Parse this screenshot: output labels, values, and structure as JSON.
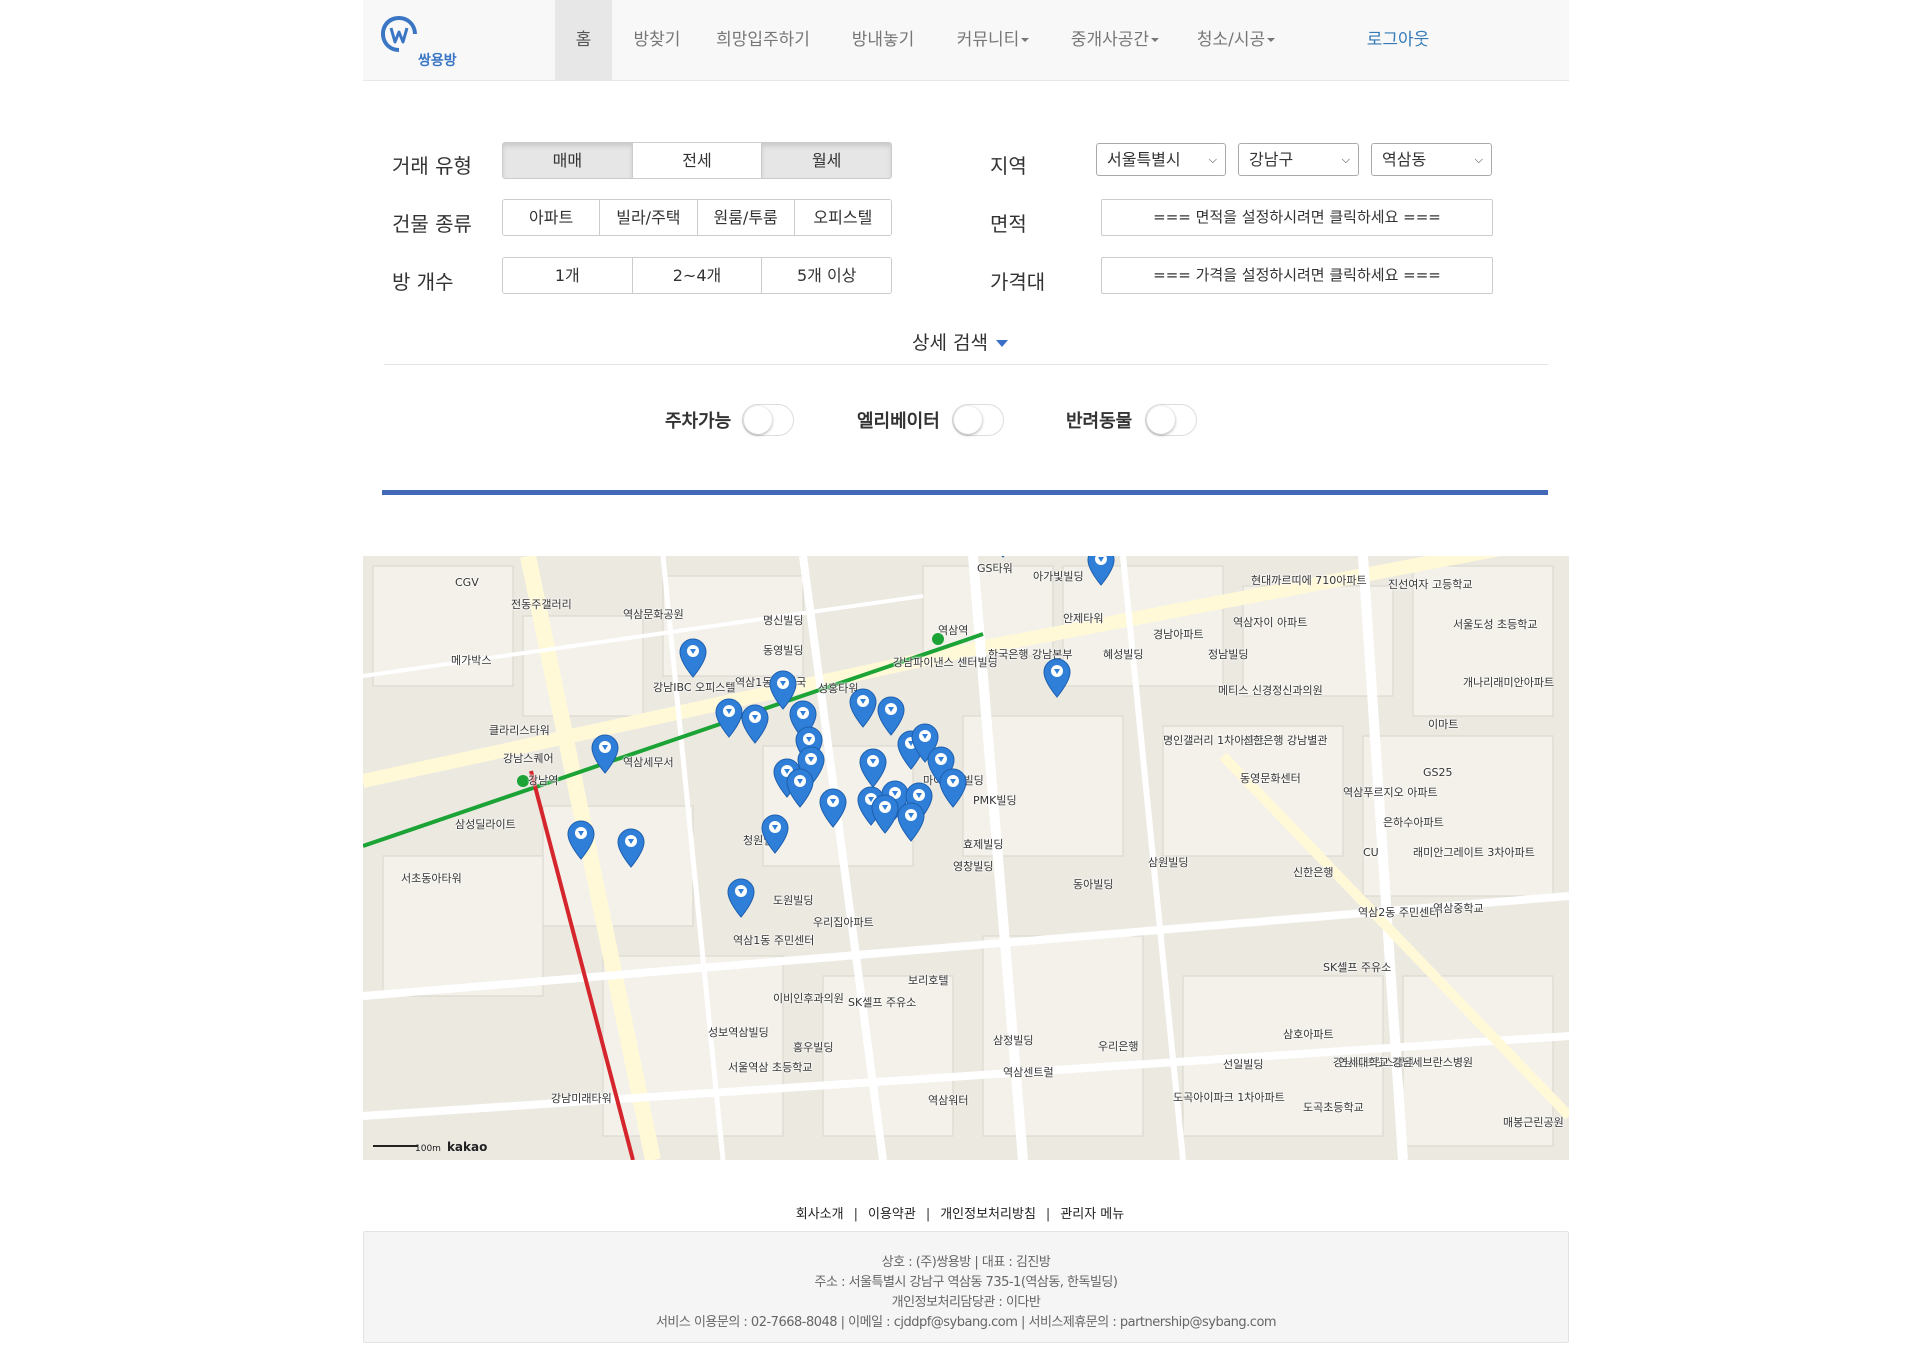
{
  "brand": {
    "name": "쌍용방"
  },
  "nav": {
    "home": "홈",
    "find_room": "방찾기",
    "wish": "희망입주하기",
    "list_room": "방내놓기",
    "community": "커뮤니티",
    "broker": "중개사공간",
    "cleaning": "청소/시공",
    "logout": "로그아웃"
  },
  "search": {
    "deal_type_label": "거래 유형",
    "deal_types": [
      "매매",
      "전세",
      "월세"
    ],
    "deal_types_selected": [
      "매매",
      "월세"
    ],
    "building_label": "건물 종류",
    "building_types": [
      "아파트",
      "빌라/주택",
      "원룸/투룸",
      "오피스텔"
    ],
    "rooms_label": "방 개수",
    "rooms": [
      "1개",
      "2~4개",
      "5개 이상"
    ],
    "region_label": "지역",
    "region_city": "서울특별시",
    "region_district": "강남구",
    "region_dong": "역삼동",
    "area_label": "면적",
    "area_button": "=== 면적을 설정하시려면 클릭하세요 ===",
    "price_label": "가격대",
    "price_button": "=== 가격을 설정하시려면 클릭하세요 ===",
    "detail_search": "상세 검색",
    "options": {
      "parking": "주차가능",
      "elevator": "엘리베이터",
      "pets": "반려동물"
    }
  },
  "map": {
    "attribution": "kakao",
    "scale": "100m",
    "labels": {
      "cgv": "CGV",
      "jeonggeun": "전동주갤러리",
      "yeoksam_culture": "역삼문화공원",
      "myeongsin": "명신빌딩",
      "dongyeong": "동영빌딩",
      "ibc": "강남IBC 오피스텔",
      "yeoksam1_center": "역삼1동 우체국",
      "seonghong": "성홍타워",
      "gangnam_finance": "강남파이낸스 센터빌딩",
      "yeoksam_station": "역삼역",
      "gs_tower": "GS타워",
      "agabit": "아가빛빌딩",
      "antae": "안제타워",
      "hanguk_bank": "한국은행 강남본부",
      "haesung": "혜성빌딩",
      "gangnam_station": "강남역",
      "gangnam_square": "강남스퀘어",
      "clarks": "클라리스타워",
      "meritz": "메가박스",
      "samsung_town": "삼성딜라이트",
      "seocho_dong": "서초동아타워",
      "jewon": "역삼세무서",
      "cheongwon": "청원빌딩",
      "dowon": "도원빌딩",
      "urijip": "우리집아파트",
      "yeoksam1dong": "역삼1동 주민센터",
      "ibihum": "이비인후과의원",
      "sk_self": "SK셀프 주유소",
      "bori": "보리호텔",
      "seongbo": "성보역삼빌딩",
      "seoul_yeoksam_school": "서울역삼 초등학교",
      "hongwoo": "홍우빌딩",
      "samjeong": "삼정빌딩",
      "woori_bank": "우리은행",
      "gangnam_hall": "강남미래타워",
      "yeoksam_water": "역삼워터",
      "yeoksam_dong2": "역삼2동 주민센터",
      "gangnam_sebeul": "강남세브란스병원",
      "seonil": "선일빌딩",
      "dogok": "도곡아이파크 1차아파트",
      "yeoksam_centum": "역삼센트럴",
      "pmk": "PMK빌딩",
      "maidas": "마이다스빌딩",
      "hyojae": "효제빌딩",
      "yeongchang": "영창빌딩",
      "dona": "동아빌딩",
      "samwon": "삼원빌딩",
      "hanjin": "신한은행",
      "gaenari": "개나리래미안아파트",
      "ymca": "역삼푸르지오 아파트",
      "ihouse": "이마트",
      "seoul_dodo": "서울도성 초등학교",
      "hanmi_high": "진선여자 고등학교",
      "hyundai": "현대까르띠에 710아파트",
      "yeoksam_ipark": "역삼자이 아파트",
      "kyeongsam": "경남아파트",
      "jeongnam": "정남빌딩",
      "meteus": "메티스 신경정신과의원",
      "gs25": "GS25",
      "myungin": "명인갤러리 1차아파트",
      "sinhan_gangnam": "신한은행 강남별관",
      "dongyoung_culture": "동영문화센터",
      "eunha": "은하수아파트",
      "remian": "래미안그레이트 3차아파트",
      "cu": "CU",
      "yeoksam_mid": "역삼중학교",
      "sk_self2": "SK셀프 주유소",
      "samho": "삼호아파트",
      "yeonse": "연세대학교 강남세브란스병원",
      "dogok_school": "도곡초등학교",
      "maebong": "매봉근린공원"
    }
  },
  "footer": {
    "links": [
      "회사소개",
      "이용약관",
      "개인정보처리방침",
      "관리자 메뉴"
    ],
    "company": "상호 : (주)쌍용방 | 대표 : 김진방",
    "address": "주소 : 서울특별시 강남구 역삼동 735-1(역삼동, 한독빌딩)",
    "privacy": "개인정보처리담당관 : 이다반",
    "contact": "서비스 이용문의 : 02-7668-8048 | 이메일 : cjddpf@sybang.com | 서비스제휴문의 : partnership@sybang.com"
  },
  "colors": {
    "accent": "#4169b8",
    "pin": "#2f7fd8",
    "subway_green": "#1ba336",
    "subway_red": "#d4262c"
  }
}
